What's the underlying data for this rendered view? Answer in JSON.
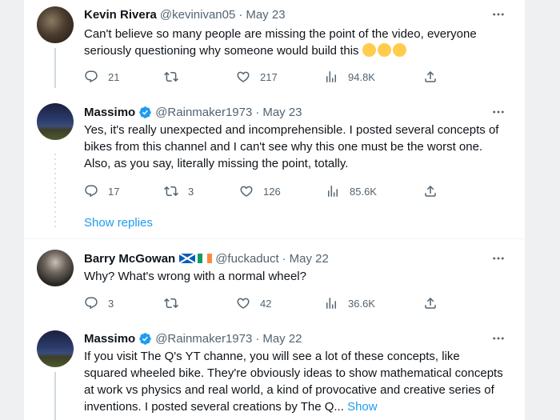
{
  "tweets": [
    {
      "name": "Kevin Rivera",
      "handle": "@kevinivan05",
      "sep": "·",
      "date": "May 23",
      "text": "Can't believe so many people are missing the point of the video, everyone seriously questioning why someone would build this",
      "emojis": [
        "crying-face",
        "laughing-face",
        "laughing-face"
      ],
      "replies": "21",
      "retweets": "",
      "likes": "217",
      "views": "94.8K",
      "verified": false
    },
    {
      "name": "Massimo",
      "handle": "@Rainmaker1973",
      "sep": "·",
      "date": "May 23",
      "text": "Yes, it's really unexpected and incomprehensible. I posted several concepts of bikes from this channel and I can't see why this one must be the worst one. Also, as you say, literally missing the point, totally.",
      "replies": "17",
      "retweets": "3",
      "likes": "126",
      "views": "85.6K",
      "verified": true
    },
    {
      "name": "Barry McGowan",
      "handle": "@fuckaduct",
      "sep": "·",
      "date": "May 22",
      "text": "Why? What's wrong with a normal wheel?",
      "replies": "3",
      "retweets": "",
      "likes": "42",
      "views": "36.6K",
      "flags": [
        "scotland-flag",
        "ireland-flag"
      ],
      "verified": false
    },
    {
      "name": "Massimo",
      "handle": "@Rainmaker1973",
      "sep": "·",
      "date": "May 22",
      "text": "If you visit The Q's YT channe, you will see a lot of these concepts, like squared wheeled bike. They're obviously ideas to show mathematical concepts at work vs physics and real world, a kind of provocative and creative series of inventions. I posted several creations by The Q...",
      "show_more": "Show",
      "verified": true
    }
  ],
  "show_replies": "Show replies",
  "colors": {
    "accent": "#1d9bf0",
    "muted": "#536471",
    "text": "#0f1419",
    "verified": "#1d9bf0"
  },
  "icons": [
    "more-icon",
    "reply-icon",
    "retweet-icon",
    "like-icon",
    "views-icon",
    "share-icon",
    "verified-icon"
  ]
}
